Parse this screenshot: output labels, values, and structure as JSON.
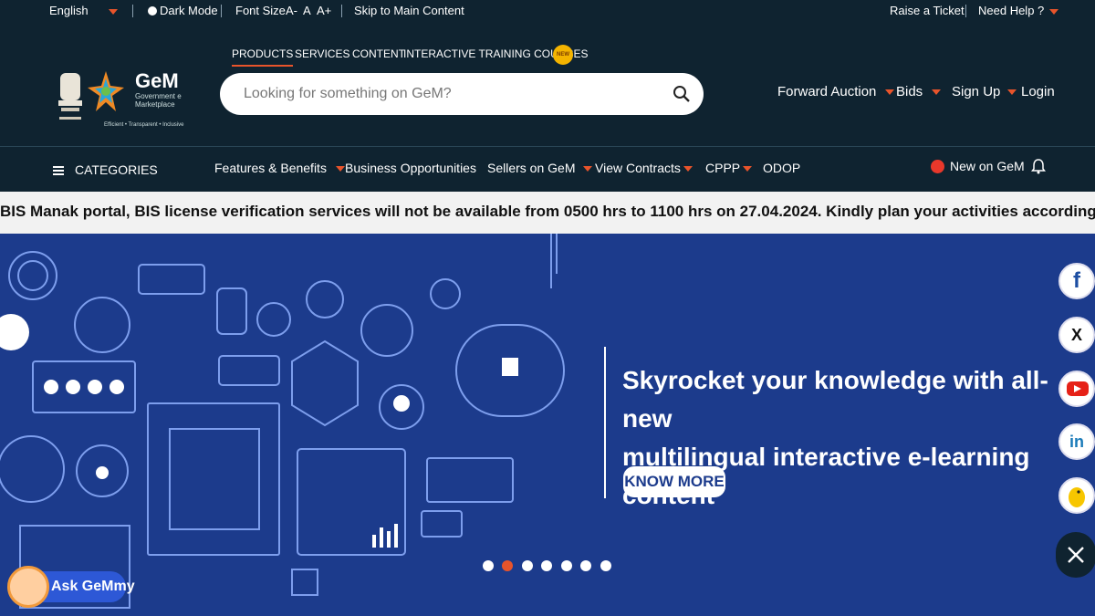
{
  "topbar": {
    "language": "English",
    "dark_mode": "Dark Mode",
    "font_size_label": "Font Size",
    "font_minus": "A-",
    "font_normal": "A",
    "font_plus": "A+",
    "skip_link": "Skip to Main Content",
    "raise_ticket": "Raise a Ticket",
    "need_help": "Need Help ?"
  },
  "logo": {
    "brand": "GeM",
    "brand_sub": "Government e Marketplace",
    "tagline": "Efficient • Transparent • Inclusive"
  },
  "tabs": [
    {
      "label": "PRODUCTS",
      "active": true
    },
    {
      "label": "SERVICES",
      "active": false
    },
    {
      "label": "CONTENT",
      "active": false
    },
    {
      "label": "INTERACTIVE TRAINING COURSES",
      "active": false
    }
  ],
  "new_badge": "NEW",
  "search": {
    "placeholder": "Looking for something on GeM?"
  },
  "rightnav": {
    "forward_auction": "Forward Auction",
    "bids": "Bids",
    "sign_up": "Sign Up",
    "login": "Login"
  },
  "catbar": {
    "categories": "CATEGORIES",
    "items": [
      "Features & Benefits",
      "Business Opportunities",
      "Sellers on GeM",
      "View Contracts",
      "CPPP",
      "ODOP"
    ],
    "new_on_gem": "New on GeM"
  },
  "ticker": "BIS Manak portal, BIS license verification services will not be available from 0500 hrs to 1100 hrs on 27.04.2024. Kindly plan your activities accordingly. Inconvenience is r",
  "hero": {
    "title_line1": "Skyrocket your knowledge with all-new",
    "title_line2": "multilingual interactive e-learning content",
    "cta": "KNOW MORE",
    "slide_count": 7,
    "active_slide": 2
  },
  "social": [
    "facebook-icon",
    "x-icon",
    "youtube-icon",
    "linkedin-icon",
    "koo-icon"
  ],
  "chatbot": "Ask GeMmy",
  "colors": {
    "accent": "#e8542b",
    "header_bg": "#0f2330",
    "hero_bg": "#1c3b8c"
  }
}
